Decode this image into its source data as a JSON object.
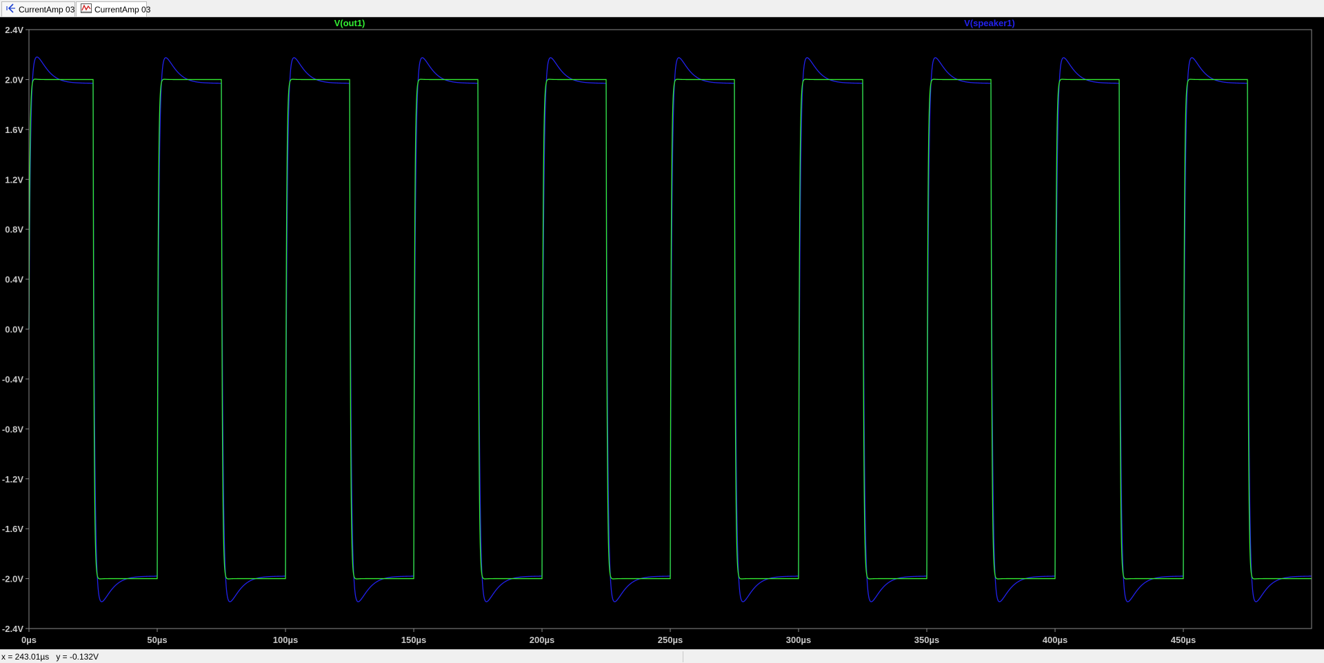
{
  "tabs": [
    {
      "label": "CurrentAmp 03",
      "icon": "schematic-icon"
    },
    {
      "label": "CurrentAmp 03",
      "icon": "waveform-icon"
    }
  ],
  "status": {
    "cursor_x": "x = 243.01µs",
    "cursor_y": "y = -0.132V"
  },
  "colors": {
    "background": "#000000",
    "grid_frame": "#8c8c8c",
    "tick_text": "#c8c8c8",
    "out1": "#33ee33",
    "speaker1": "#2222ee"
  },
  "chart_data": {
    "type": "line",
    "title": "",
    "xlabel": "",
    "ylabel": "",
    "xlim": [
      0,
      500
    ],
    "ylim": [
      -2.4,
      2.4
    ],
    "grid": false,
    "x_ticks": [
      "0µs",
      "50µs",
      "100µs",
      "150µs",
      "200µs",
      "250µs",
      "300µs",
      "350µs",
      "400µs",
      "450µs"
    ],
    "x_tick_values": [
      0,
      50,
      100,
      150,
      200,
      250,
      300,
      350,
      400,
      450
    ],
    "y_ticks": [
      "2.4V",
      "2.0V",
      "1.6V",
      "1.2V",
      "0.8V",
      "0.4V",
      "0.0V",
      "-0.4V",
      "-0.8V",
      "-1.2V",
      "-1.6V",
      "-2.0V",
      "-2.4V"
    ],
    "y_tick_values": [
      2.4,
      2.0,
      1.6,
      1.2,
      0.8,
      0.4,
      0.0,
      -0.4,
      -0.8,
      -1.2,
      -1.6,
      -2.0,
      -2.4
    ],
    "x_unit": "µs",
    "y_unit": "V",
    "signal": {
      "kind": "square",
      "period_us": 50,
      "duty": 0.5,
      "high_v": 2.0,
      "low_v": -2.0
    },
    "series": [
      {
        "name": "V(out1)",
        "color": "#33ee33",
        "high_v": 2.0,
        "low_v": -2.0,
        "overshoot_v": 0.02,
        "settle_us": 2
      },
      {
        "name": "V(speaker1)",
        "color": "#2222ee",
        "high_v": 1.97,
        "low_v": -1.98,
        "overshoot_v": 0.22,
        "settle_us": 8
      }
    ]
  }
}
